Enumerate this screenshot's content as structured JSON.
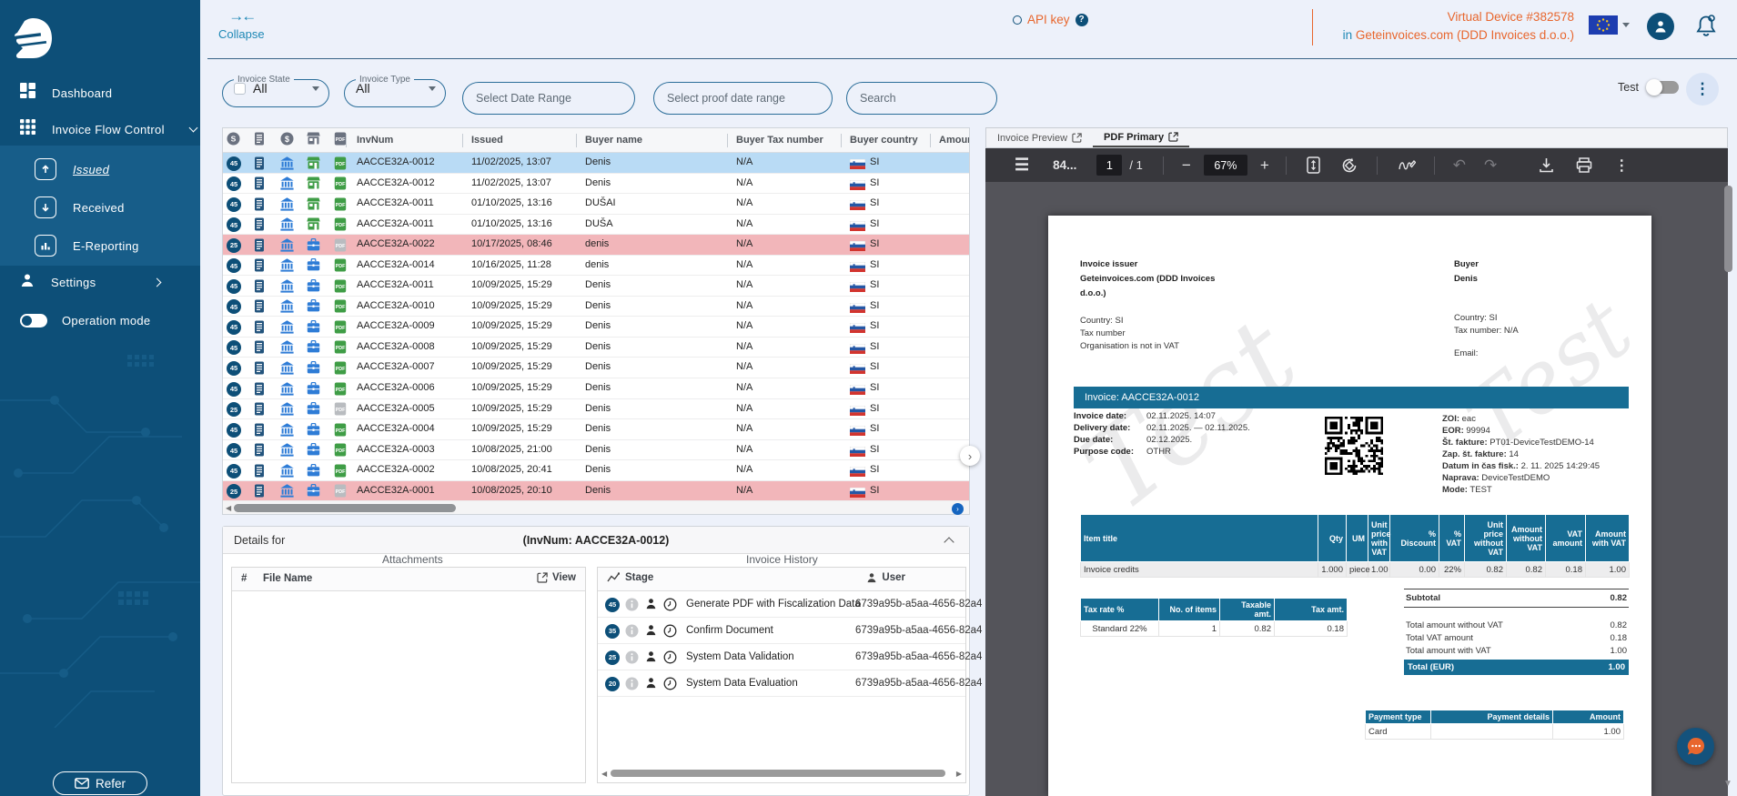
{
  "colors": {
    "accent": "#1e88b5",
    "orange": "#e8662d",
    "navy": "#0d4f78",
    "doc_teal": "#176d94",
    "green": "#3f9d46",
    "row_selected": "#b9dbf5",
    "row_error": "#f2b6ba"
  },
  "topbar": {
    "collapse_label": "Collapse",
    "api_key_label": "API key",
    "device_title": "Virtual Device #382578",
    "device_in": "in",
    "device_org": "Geteinvoices.com (DDD Invoices d.o.o.)"
  },
  "sidebar": {
    "items": [
      {
        "label": "Dashboard"
      },
      {
        "label": "Invoice Flow Control"
      },
      {
        "label": "Issued"
      },
      {
        "label": "Received"
      },
      {
        "label": "E-Reporting"
      },
      {
        "label": "Settings"
      },
      {
        "label": "Operation mode"
      }
    ],
    "refer_label": "Refer"
  },
  "filters": {
    "state_label": "Invoice State",
    "state_value": "All",
    "type_label": "Invoice Type",
    "type_value": "All",
    "date_placeholder": "Select Date Range",
    "proof_placeholder": "Select proof date range",
    "search_placeholder": "Search",
    "test_label": "Test"
  },
  "table": {
    "headers": {
      "invnum": "InvNum",
      "issued": "Issued",
      "buyer": "Buyer name",
      "tax": "Buyer Tax number",
      "country": "Buyer country",
      "amount": "Amount"
    },
    "rows": [
      {
        "badge": "45",
        "store": "green",
        "pdf": "green",
        "invnum": "AACCE32A-0012",
        "issued": "11/02/2025, 13:07",
        "buyer": "Denis",
        "tax": "N/A",
        "country": "SI",
        "state": "selected"
      },
      {
        "badge": "45",
        "store": "green",
        "pdf": "green",
        "invnum": "AACCE32A-0012",
        "issued": "11/02/2025, 13:07",
        "buyer": "Denis",
        "tax": "N/A",
        "country": "SI",
        "state": ""
      },
      {
        "badge": "45",
        "store": "green",
        "pdf": "green",
        "invnum": "AACCE32A-0011",
        "issued": "01/10/2025, 13:16",
        "buyer": "DUŠAI",
        "tax": "N/A",
        "country": "SI",
        "state": ""
      },
      {
        "badge": "45",
        "store": "green",
        "pdf": "green",
        "invnum": "AACCE32A-0011",
        "issued": "01/10/2025, 13:16",
        "buyer": "DUŠA",
        "tax": "N/A",
        "country": "SI",
        "state": ""
      },
      {
        "badge": "25",
        "store": "blue",
        "pdf": "gray",
        "invnum": "AACCE32A-0022",
        "issued": "10/17/2025, 08:46",
        "buyer": "denis",
        "tax": "N/A",
        "country": "SI",
        "state": "error"
      },
      {
        "badge": "45",
        "store": "blue",
        "pdf": "green",
        "invnum": "AACCE32A-0014",
        "issued": "10/16/2025, 11:28",
        "buyer": "denis",
        "tax": "N/A",
        "country": "SI",
        "state": ""
      },
      {
        "badge": "45",
        "store": "blue",
        "pdf": "green",
        "invnum": "AACCE32A-0011",
        "issued": "10/09/2025, 15:29",
        "buyer": "Denis",
        "tax": "N/A",
        "country": "SI",
        "state": ""
      },
      {
        "badge": "45",
        "store": "blue",
        "pdf": "green",
        "invnum": "AACCE32A-0010",
        "issued": "10/09/2025, 15:29",
        "buyer": "Denis",
        "tax": "N/A",
        "country": "SI",
        "state": ""
      },
      {
        "badge": "45",
        "store": "blue",
        "pdf": "green",
        "invnum": "AACCE32A-0009",
        "issued": "10/09/2025, 15:29",
        "buyer": "Denis",
        "tax": "N/A",
        "country": "SI",
        "state": ""
      },
      {
        "badge": "45",
        "store": "blue",
        "pdf": "green",
        "invnum": "AACCE32A-0008",
        "issued": "10/09/2025, 15:29",
        "buyer": "Denis",
        "tax": "N/A",
        "country": "SI",
        "state": ""
      },
      {
        "badge": "45",
        "store": "blue",
        "pdf": "green",
        "invnum": "AACCE32A-0007",
        "issued": "10/09/2025, 15:29",
        "buyer": "Denis",
        "tax": "N/A",
        "country": "SI",
        "state": ""
      },
      {
        "badge": "45",
        "store": "blue",
        "pdf": "green",
        "invnum": "AACCE32A-0006",
        "issued": "10/09/2025, 15:29",
        "buyer": "Denis",
        "tax": "N/A",
        "country": "SI",
        "state": ""
      },
      {
        "badge": "25",
        "store": "blue",
        "pdf": "gray",
        "invnum": "AACCE32A-0005",
        "issued": "10/09/2025, 15:29",
        "buyer": "Denis",
        "tax": "N/A",
        "country": "SI",
        "state": ""
      },
      {
        "badge": "45",
        "store": "blue",
        "pdf": "green",
        "invnum": "AACCE32A-0004",
        "issued": "10/09/2025, 15:29",
        "buyer": "Denis",
        "tax": "N/A",
        "country": "SI",
        "state": ""
      },
      {
        "badge": "45",
        "store": "blue",
        "pdf": "green",
        "invnum": "AACCE32A-0003",
        "issued": "10/08/2025, 21:00",
        "buyer": "Denis",
        "tax": "N/A",
        "country": "SI",
        "state": ""
      },
      {
        "badge": "45",
        "store": "blue",
        "pdf": "green",
        "invnum": "AACCE32A-0002",
        "issued": "10/08/2025, 20:41",
        "buyer": "Denis",
        "tax": "N/A",
        "country": "SI",
        "state": ""
      },
      {
        "badge": "25",
        "store": "blue",
        "pdf": "gray",
        "invnum": "AACCE32A-0001",
        "issued": "10/08/2025, 20:10",
        "buyer": "Denis",
        "tax": "N/A",
        "country": "SI",
        "state": "error"
      }
    ]
  },
  "details": {
    "title": "Details for",
    "invnum": "(InvNum: AACCE32A-0012)",
    "attachments": {
      "title": "Attachments",
      "col_hash": "#",
      "col_file": "File Name",
      "col_view": "View"
    },
    "history": {
      "title": "Invoice History",
      "col_stage": "Stage",
      "col_user": "User",
      "rows": [
        {
          "badge": "45",
          "stage": "Generate PDF with Fiscalization Data",
          "user": "6739a95b-a5aa-4656-82a4"
        },
        {
          "badge": "35",
          "stage": "Confirm Document",
          "user": "6739a95b-a5aa-4656-82a4"
        },
        {
          "badge": "25",
          "stage": "System Data Validation",
          "user": "6739a95b-a5aa-4656-82a4"
        },
        {
          "badge": "20",
          "stage": "System Data Evaluation",
          "user": "6739a95b-a5aa-4656-82a4"
        }
      ]
    }
  },
  "pdf_panel": {
    "tabs": [
      {
        "label": "Invoice Preview"
      },
      {
        "label": "PDF Primary"
      }
    ],
    "toolbar": {
      "title": "84...",
      "page_current": "1",
      "page_sep": "/",
      "page_total": "1",
      "zoom": "67%"
    }
  },
  "document": {
    "issuer_label": "Invoice issuer",
    "issuer_name_l1": "Geteinvoices.com (DDD Invoices",
    "issuer_name_l2": "d.o.o.)",
    "issuer_country": "Country:  SI",
    "issuer_tax": "Tax number",
    "issuer_vat_note": "Organisation is not in VAT",
    "buyer_label": "Buyer",
    "buyer_name": "Denis",
    "buyer_country": "Country:  SI",
    "buyer_tax": "Tax number: N/A",
    "buyer_email": "Email:",
    "invoice_title": "Invoice: AACCE32A-0012",
    "meta": [
      [
        "Invoice date:",
        "02.11.2025. 14:07"
      ],
      [
        "Delivery date:",
        "02.11.2025. — 02.11.2025."
      ],
      [
        "Due date:",
        "02.12.2025."
      ],
      [
        "Purpose code:",
        "OTHR"
      ]
    ],
    "fiscal": [
      [
        "ZOI:",
        "eac"
      ],
      [
        "EOR:",
        "99994"
      ],
      [
        "Št. fakture:",
        "PT01-DeviceTestDEMO-14"
      ],
      [
        "Zap. št. fakture:",
        "14"
      ],
      [
        "Datum in čas fisk.:",
        "2. 11. 2025 14:29:45"
      ],
      [
        "Naprava:",
        "DeviceTestDEMO"
      ],
      [
        "Mode:",
        "TEST"
      ]
    ],
    "items": {
      "headers": [
        "Item title",
        "Qty",
        "UM",
        "Unit price with VAT",
        "% Discount",
        "% VAT",
        "Unit price without VAT",
        "Amount without VAT",
        "VAT amount",
        "Amount with VAT"
      ],
      "rows": [
        [
          "Invoice credits",
          "1.000",
          "piece",
          "1.00",
          "0.00",
          "22%",
          "0.82",
          "0.82",
          "0.18",
          "1.00"
        ]
      ]
    },
    "tax": {
      "headers": [
        "Tax rate %",
        "No. of items",
        "Taxable amt.",
        "Tax amt."
      ],
      "rows": [
        [
          "Standard 22%",
          "1",
          "0.82",
          "0.18"
        ]
      ]
    },
    "totals": {
      "subtotal_label": "Subtotal",
      "subtotal": "0.82",
      "rows": [
        [
          "Total amount without VAT",
          "0.82"
        ],
        [
          "Total VAT amount",
          "0.18"
        ],
        [
          "Total amount with VAT",
          "1.00"
        ]
      ],
      "total_label": "Total (EUR)",
      "total": "1.00"
    },
    "payment": {
      "headers": [
        "Payment type",
        "Payment details",
        "Amount"
      ],
      "rows": [
        [
          "Card",
          "",
          "1.00"
        ]
      ]
    },
    "watermark": "Test"
  }
}
